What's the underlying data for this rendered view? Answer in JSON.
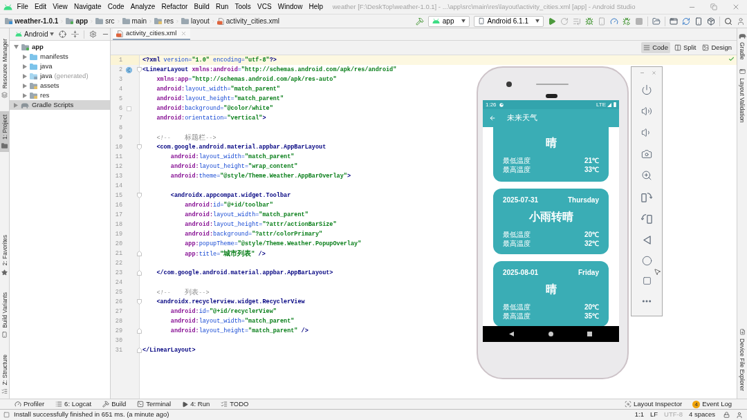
{
  "window": {
    "title": "weather [F:\\DeskTop\\weather-1.0.1] - ...\\app\\src\\main\\res\\layout\\activity_cities.xml [app] - Android Studio"
  },
  "menu": [
    "File",
    "Edit",
    "View",
    "Navigate",
    "Code",
    "Analyze",
    "Refactor",
    "Build",
    "Run",
    "Tools",
    "VCS",
    "Window",
    "Help"
  ],
  "breadcrumb": [
    {
      "kind": "project",
      "label": "weather-1.0.1"
    },
    {
      "kind": "module",
      "label": "app"
    },
    {
      "kind": "folder",
      "label": "src"
    },
    {
      "kind": "folder",
      "label": "main"
    },
    {
      "kind": "res",
      "label": "res"
    },
    {
      "kind": "folder",
      "label": "layout"
    },
    {
      "kind": "layout",
      "label": "activity_cities.xml"
    }
  ],
  "toolbar": {
    "items": [
      {
        "kind": "build",
        "disabled": false
      },
      {
        "kind": "configuration",
        "label": "app",
        "disabled": false
      },
      {
        "kind": "device",
        "label": "Android 6.1.1",
        "disabled": false
      },
      {
        "kind": "run",
        "disabled": false
      },
      {
        "kind": "rerun",
        "disabled": true
      },
      {
        "kind": "apply",
        "disabled": true
      },
      {
        "kind": "debug",
        "disabled": false
      },
      {
        "kind": "attach",
        "disabled": true
      },
      {
        "kind": "profile",
        "disabled": false
      },
      {
        "kind": "debug-attach",
        "disabled": false
      },
      {
        "kind": "stop",
        "disabled": true
      },
      {
        "kind": "device-explorer",
        "disabled": false
      },
      {
        "kind": "preview",
        "disabled": false
      },
      {
        "kind": "sync",
        "disabled": false
      },
      {
        "kind": "avd",
        "disabled": false
      },
      {
        "kind": "sdk",
        "disabled": false
      },
      {
        "kind": "search",
        "disabled": false
      },
      {
        "kind": "account",
        "disabled": false
      }
    ]
  },
  "left_tool_windows": {
    "top": [
      {
        "kind": "resource-manager",
        "label": "Resource Manager",
        "selected": false
      },
      {
        "kind": "project",
        "label": "1: Project",
        "selected": true
      }
    ],
    "bottom": [
      {
        "kind": "favorites",
        "label": "2: Favorites",
        "selected": false
      },
      {
        "kind": "build-variants",
        "label": "Build Variants",
        "selected": false
      },
      {
        "kind": "structure",
        "label": "Z: Structure",
        "selected": false
      }
    ]
  },
  "right_tool_windows": {
    "top": [
      {
        "kind": "gradle",
        "label": "Gradle",
        "selected": false
      },
      {
        "kind": "layout-validation",
        "label": "Layout Validation",
        "selected": false
      }
    ],
    "bottom": [
      {
        "kind": "device-explorer",
        "label": "Device File Explorer",
        "selected": false
      }
    ]
  },
  "project_panel": {
    "view": "Android",
    "tree": [
      {
        "kind": "module",
        "label": "app",
        "expanded": true,
        "selected": false,
        "children": [
          {
            "kind": "folder",
            "label": "manifests",
            "expanded": false,
            "selected": false
          },
          {
            "kind": "folder",
            "label": "java",
            "expanded": false,
            "selected": false
          },
          {
            "kind": "generated",
            "label": "java",
            "note": "(generated)",
            "expanded": false,
            "selected": false
          },
          {
            "kind": "resource",
            "label": "assets",
            "expanded": false,
            "selected": false
          },
          {
            "kind": "resource",
            "label": "res",
            "expanded": false,
            "selected": false
          }
        ]
      },
      {
        "kind": "gradle",
        "label": "Gradle Scripts",
        "expanded": false,
        "selected": true
      }
    ]
  },
  "editor": {
    "tabs": [
      {
        "label": "activity_cities.xml",
        "selected": true
      }
    ],
    "view_modes": [
      {
        "kind": "code",
        "label": "Code",
        "selected": true
      },
      {
        "kind": "split",
        "label": "Split",
        "selected": false
      },
      {
        "kind": "design",
        "label": "Design",
        "selected": false
      }
    ],
    "lines": [
      {
        "number": "1",
        "current": true,
        "tokens": [
          {
            "kind": "tag",
            "text": "<?xml "
          },
          {
            "kind": "attr",
            "text": "version="
          },
          {
            "kind": "value",
            "text": "\"1.0\" "
          },
          {
            "kind": "attr",
            "text": "encoding="
          },
          {
            "kind": "value",
            "text": "\"utf-8\""
          },
          {
            "kind": "tag",
            "text": "?>"
          }
        ]
      },
      {
        "number": "2",
        "current": false,
        "gutter": [
          {
            "kind": "class"
          },
          {
            "kind": "fold-start"
          }
        ],
        "tokens": [
          {
            "kind": "tag",
            "text": "<LinearLayout "
          },
          {
            "kind": "ns",
            "text": "xmlns:android"
          },
          {
            "kind": "attr",
            "text": "="
          },
          {
            "kind": "value",
            "text": "\"http://schemas.android.com/apk/res/android\""
          }
        ]
      },
      {
        "number": "3",
        "current": false,
        "tokens": [
          {
            "kind": "ns",
            "text": "    xmlns:app"
          },
          {
            "kind": "attr",
            "text": "="
          },
          {
            "kind": "value",
            "text": "\"http://schemas.android.com/apk/res-auto\""
          }
        ]
      },
      {
        "number": "4",
        "current": false,
        "tokens": [
          {
            "kind": "ns",
            "text": "    android:"
          },
          {
            "kind": "attr",
            "text": "layout_width="
          },
          {
            "kind": "value",
            "text": "\"match_parent\""
          }
        ]
      },
      {
        "number": "5",
        "current": false,
        "tokens": [
          {
            "kind": "ns",
            "text": "    android:"
          },
          {
            "kind": "attr",
            "text": "layout_height="
          },
          {
            "kind": "value",
            "text": "\"match_parent\""
          }
        ]
      },
      {
        "number": "6",
        "current": false,
        "gutter": [
          {
            "kind": "swatch",
            "color": "#ffffff"
          }
        ],
        "tokens": [
          {
            "kind": "ns",
            "text": "    android:"
          },
          {
            "kind": "attr",
            "text": "background="
          },
          {
            "kind": "value",
            "text": "\"@color/white\""
          }
        ]
      },
      {
        "number": "7",
        "current": false,
        "tokens": [
          {
            "kind": "ns",
            "text": "    android:"
          },
          {
            "kind": "attr",
            "text": "orientation="
          },
          {
            "kind": "value",
            "text": "\"vertical\""
          },
          {
            "kind": "tag",
            "text": ">"
          }
        ]
      },
      {
        "number": "8",
        "current": false
      },
      {
        "number": "9",
        "current": false,
        "tokens": [
          {
            "kind": "comment",
            "text": "    <!--    标题栏-->"
          }
        ]
      },
      {
        "number": "10",
        "current": false,
        "gutter": [
          {
            "kind": "fold-start"
          }
        ],
        "tokens": [
          {
            "kind": "tag",
            "text": "    <com.google.android.material.appbar.AppBarLayout"
          }
        ]
      },
      {
        "number": "11",
        "current": false,
        "tokens": [
          {
            "kind": "ns",
            "text": "        android:"
          },
          {
            "kind": "attr",
            "text": "layout_width="
          },
          {
            "kind": "value",
            "text": "\"match_parent\""
          }
        ]
      },
      {
        "number": "12",
        "current": false,
        "tokens": [
          {
            "kind": "ns",
            "text": "        android:"
          },
          {
            "kind": "attr",
            "text": "layout_height="
          },
          {
            "kind": "value",
            "text": "\"wrap_content\""
          }
        ]
      },
      {
        "number": "13",
        "current": false,
        "tokens": [
          {
            "kind": "ns",
            "text": "        android:"
          },
          {
            "kind": "attr",
            "text": "theme="
          },
          {
            "kind": "value",
            "text": "\"@style/Theme.Weather.AppBarOverlay\""
          },
          {
            "kind": "tag",
            "text": ">"
          }
        ]
      },
      {
        "number": "14",
        "current": false
      },
      {
        "number": "15",
        "current": false,
        "gutter": [
          {
            "kind": "fold-start"
          }
        ],
        "tokens": [
          {
            "kind": "tag",
            "text": "        <androidx.appcompat.widget.Toolbar"
          }
        ]
      },
      {
        "number": "16",
        "current": false,
        "tokens": [
          {
            "kind": "ns",
            "text": "            android:"
          },
          {
            "kind": "attr",
            "text": "id="
          },
          {
            "kind": "value",
            "text": "\"@+id/toolbar\""
          }
        ]
      },
      {
        "number": "17",
        "current": false,
        "tokens": [
          {
            "kind": "ns",
            "text": "            android:"
          },
          {
            "kind": "attr",
            "text": "layout_width="
          },
          {
            "kind": "value",
            "text": "\"match_parent\""
          }
        ]
      },
      {
        "number": "18",
        "current": false,
        "tokens": [
          {
            "kind": "ns",
            "text": "            android:"
          },
          {
            "kind": "attr",
            "text": "layout_height="
          },
          {
            "kind": "value",
            "text": "\"?attr/actionBarSize\""
          }
        ]
      },
      {
        "number": "19",
        "current": false,
        "tokens": [
          {
            "kind": "ns",
            "text": "            android:"
          },
          {
            "kind": "attr",
            "text": "background="
          },
          {
            "kind": "value",
            "text": "\"?attr/colorPrimary\""
          }
        ]
      },
      {
        "number": "20",
        "current": false,
        "tokens": [
          {
            "kind": "ns",
            "text": "            app:"
          },
          {
            "kind": "attr",
            "text": "popupTheme="
          },
          {
            "kind": "value",
            "text": "\"@style/Theme.Weather.PopupOverlay\""
          }
        ]
      },
      {
        "number": "21",
        "current": false,
        "gutter": [
          {
            "kind": "fold-end"
          }
        ],
        "tokens": [
          {
            "kind": "ns",
            "text": "            app:"
          },
          {
            "kind": "attr",
            "text": "title="
          },
          {
            "kind": "value",
            "text": "\"城市列表\" "
          },
          {
            "kind": "tag",
            "text": "/>"
          }
        ]
      },
      {
        "number": "22",
        "current": false
      },
      {
        "number": "23",
        "current": false,
        "gutter": [
          {
            "kind": "fold-end"
          }
        ],
        "tokens": [
          {
            "kind": "tag",
            "text": "    </com.google.android.material.appbar.AppBarLayout>"
          }
        ]
      },
      {
        "number": "24",
        "current": false
      },
      {
        "number": "25",
        "current": false,
        "tokens": [
          {
            "kind": "comment",
            "text": "    <!--    列表-->"
          }
        ]
      },
      {
        "number": "26",
        "current": false,
        "gutter": [
          {
            "kind": "fold-start"
          }
        ],
        "tokens": [
          {
            "kind": "tag",
            "text": "    <androidx.recyclerview.widget.RecyclerView"
          }
        ]
      },
      {
        "number": "27",
        "current": false,
        "tokens": [
          {
            "kind": "ns",
            "text": "        android:"
          },
          {
            "kind": "attr",
            "text": "id="
          },
          {
            "kind": "value",
            "text": "\"@+id/recyclerView\""
          }
        ]
      },
      {
        "number": "28",
        "current": false,
        "tokens": [
          {
            "kind": "ns",
            "text": "        android:"
          },
          {
            "kind": "attr",
            "text": "layout_width="
          },
          {
            "kind": "value",
            "text": "\"match_parent\""
          }
        ]
      },
      {
        "number": "29",
        "current": false,
        "gutter": [
          {
            "kind": "fold-end"
          }
        ],
        "tokens": [
          {
            "kind": "ns",
            "text": "        android:"
          },
          {
            "kind": "attr",
            "text": "layout_height="
          },
          {
            "kind": "value",
            "text": "\"match_parent\" "
          },
          {
            "kind": "tag",
            "text": "/>"
          }
        ]
      },
      {
        "number": "30",
        "current": false
      },
      {
        "number": "31",
        "current": false,
        "gutter": [
          {
            "kind": "fold-end"
          }
        ],
        "tokens": [
          {
            "kind": "tag",
            "text": "</LinearLayout>"
          }
        ]
      }
    ]
  },
  "emulator": {
    "status_bar": {
      "time": "1:26",
      "network": "LTE"
    },
    "app_bar": {
      "title": "未来天气"
    },
    "cards": [
      {
        "weather": "晴",
        "rows": [
          {
            "label": "最低温度",
            "value": "21℃"
          },
          {
            "label": "最高温度",
            "value": "33℃"
          }
        ]
      },
      {
        "date": "2025-07-31",
        "weekday": "Thursday",
        "weather": "小雨转晴",
        "rows": [
          {
            "label": "最低温度",
            "value": "20℃"
          },
          {
            "label": "最高温度",
            "value": "32℃"
          }
        ]
      },
      {
        "date": "2025-08-01",
        "weekday": "Friday",
        "weather": "晴",
        "rows": [
          {
            "label": "最低温度",
            "value": "20℃"
          },
          {
            "label": "最高温度",
            "value": "35℃"
          }
        ]
      }
    ]
  },
  "bottom_tools": {
    "left": [
      {
        "kind": "profiler",
        "label": "Profiler"
      },
      {
        "kind": "logcat",
        "label": "6: Logcat"
      },
      {
        "kind": "build",
        "label": "Build"
      },
      {
        "kind": "terminal",
        "label": "Terminal"
      },
      {
        "kind": "run",
        "label": "4: Run"
      },
      {
        "kind": "todo",
        "label": "TODO"
      }
    ],
    "right": [
      {
        "kind": "layout-inspector",
        "label": "Layout Inspector"
      },
      {
        "kind": "event-log",
        "label": "Event Log",
        "badge": "4"
      }
    ]
  },
  "status_bar": {
    "message": "Install successfully finished in 651 ms. (a minute ago)",
    "items": [
      {
        "label": "1:1",
        "disabled": false
      },
      {
        "label": "LF",
        "disabled": false
      },
      {
        "label": "UTF-8",
        "disabled": true
      },
      {
        "label": "4 spaces",
        "disabled": false
      }
    ]
  }
}
